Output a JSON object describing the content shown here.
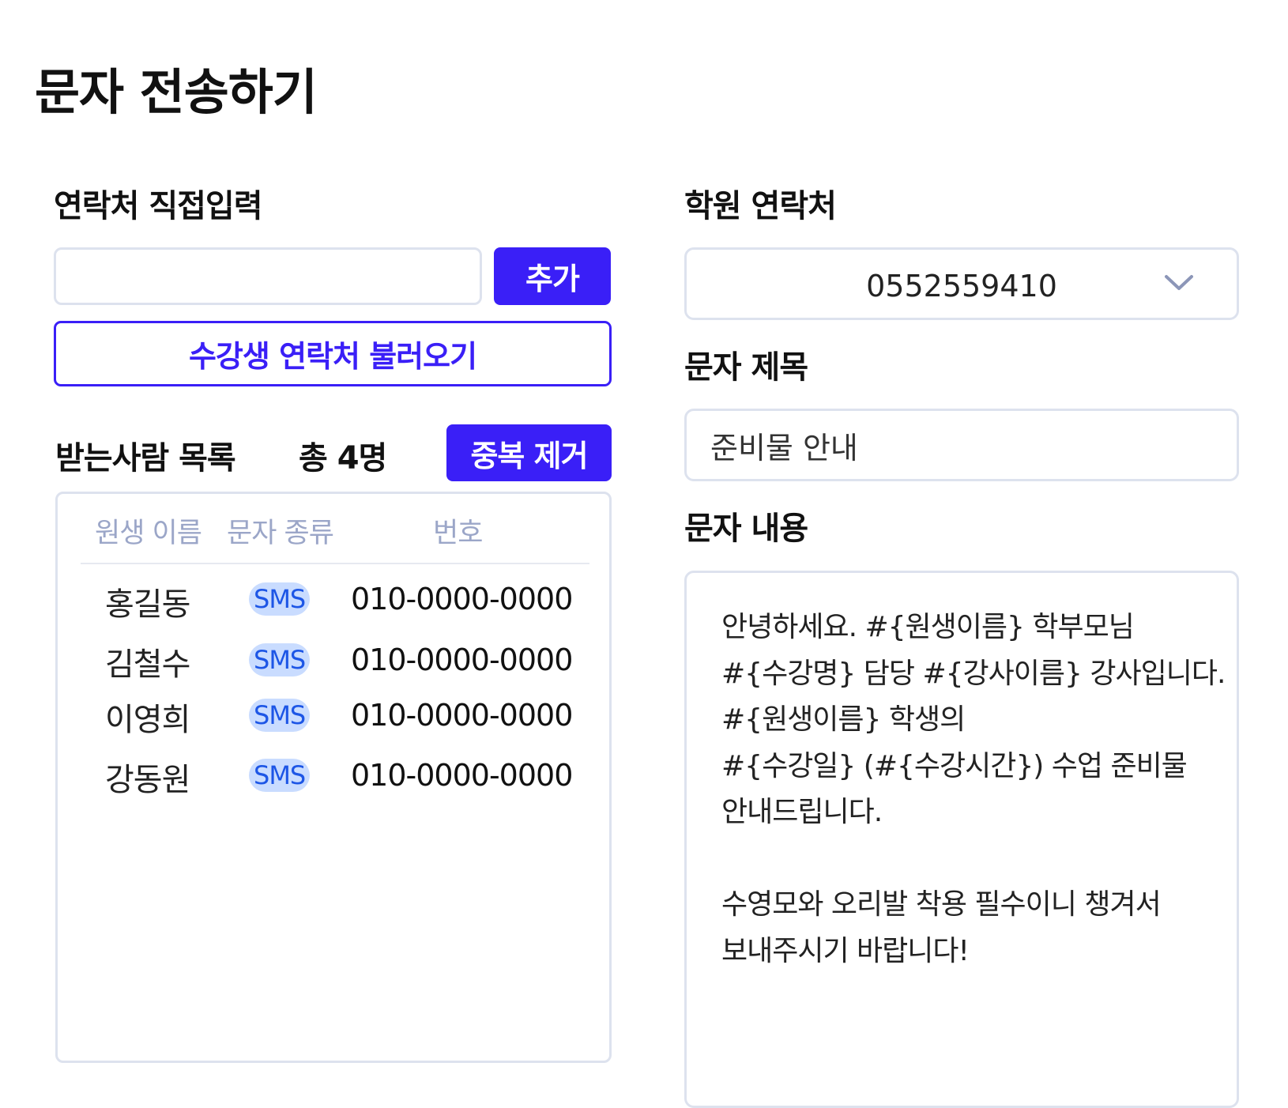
{
  "page": {
    "title": "문자 전송하기"
  },
  "direct_input": {
    "label": "연락처 직접입력",
    "value": "",
    "placeholder": "",
    "add_label": "추가",
    "load_label": "수강생 연락처 불러오기"
  },
  "recipients": {
    "label": "받는사람 목록",
    "total_text": "총 4명",
    "dedupe_label": "중복 제거",
    "columns": [
      "원생 이름",
      "문자 종류",
      "번호"
    ],
    "rows": [
      {
        "name": "홍길동",
        "type": "SMS",
        "phone": "010-0000-0000"
      },
      {
        "name": "김철수",
        "type": "SMS",
        "phone": "010-0000-0000"
      },
      {
        "name": "이영희",
        "type": "SMS",
        "phone": "010-0000-0000"
      },
      {
        "name": "강동원",
        "type": "SMS",
        "phone": "010-0000-0000"
      }
    ]
  },
  "academy_contact": {
    "label": "학원 연락처",
    "selected": "0552559410",
    "icon": "chevron-down-icon"
  },
  "message_title": {
    "label": "문자 제목",
    "value": "준비물 안내"
  },
  "message_body": {
    "label": "문자 내용",
    "lines": [
      "안녕하세요. #{원생이름} 학부모님",
      "#{수강명} 담당 #{강사이름} 강사입니다.",
      "#{원생이름} 학생의",
      "#{수강일} (#{수강시간}) 수업 준비물",
      "안내드립니다.",
      "",
      "수영모와 오리발 착용 필수이니 챙겨서",
      "보내주시기 바랍니다!"
    ]
  },
  "colors": {
    "primary": "#3a1ff7",
    "border": "#dde2ee",
    "header_text": "#9ba6c8",
    "badge_bg": "#c9dcff",
    "badge_text": "#1d56e6"
  }
}
